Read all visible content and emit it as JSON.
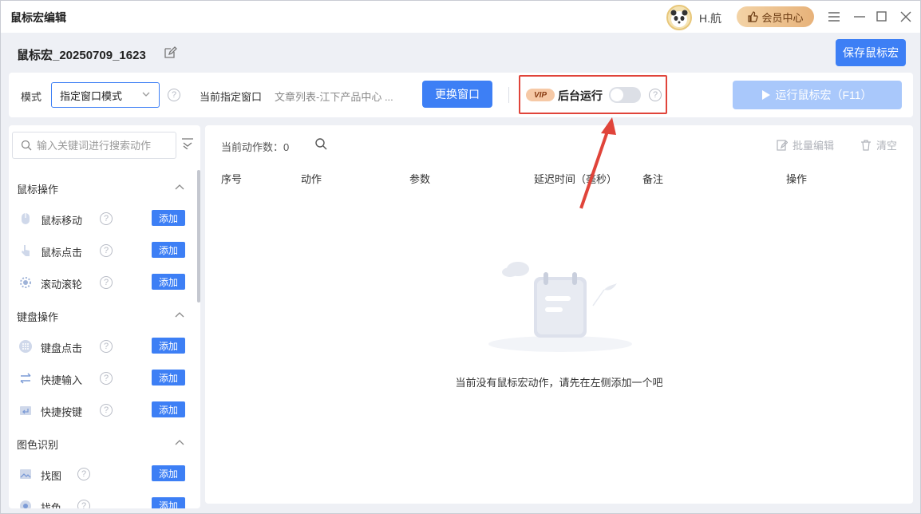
{
  "window": {
    "title": "鼠标宏编辑",
    "username": "H.航",
    "vip_center": "会员中心"
  },
  "header": {
    "macro_name": "鼠标宏_20250709_1623",
    "save_label": "保存鼠标宏"
  },
  "toolbar": {
    "mode_label": "模式",
    "mode_value": "指定窗口模式",
    "current_window_label": "当前指定窗口",
    "current_window_value": "文章列表-江下产品中心 ...",
    "change_window": "更换窗口",
    "vip_badge": "VIP",
    "background_run_label": "后台运行",
    "background_run_on": false,
    "run_label": "运行鼠标宏（F11）"
  },
  "sidebar": {
    "search_placeholder": "输入关键词进行搜索动作",
    "add_label": "添加",
    "categories": [
      {
        "title": "鼠标操作",
        "items": [
          "鼠标移动",
          "鼠标点击",
          "滚动滚轮"
        ]
      },
      {
        "title": "键盘操作",
        "items": [
          "键盘点击",
          "快捷输入",
          "快捷按键"
        ]
      },
      {
        "title": "图色识别",
        "items": [
          "找图",
          "找色"
        ]
      }
    ]
  },
  "main": {
    "count_label": "当前动作数：",
    "count_value": "0",
    "batch_edit": "批量编辑",
    "clear": "清空",
    "columns": [
      "序号",
      "动作",
      "参数",
      "延迟时间（毫秒）",
      "备注",
      "操作"
    ],
    "empty_text": "当前没有鼠标宏动作，请先在左侧添加一个吧"
  },
  "colors": {
    "primary": "#3d7ff5",
    "primary_disabled": "#a9c8fb",
    "highlight": "#e0443a"
  }
}
